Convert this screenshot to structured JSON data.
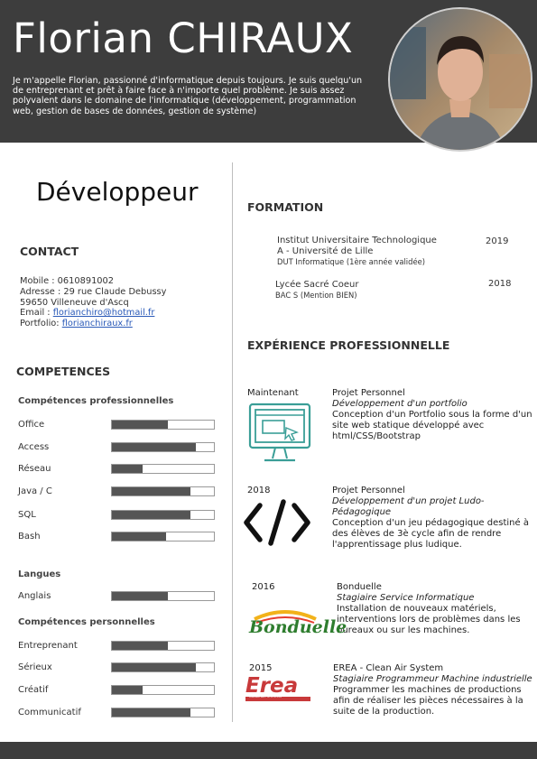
{
  "header": {
    "name": "Florian CHIRAUX",
    "intro": "Je m'appelle Florian, passionné d'informatique depuis toujours. Je suis quelqu'un de entreprenant et prêt à faire face à n'importe quel problème. Je suis assez polyvalent dans le domaine de l'informatique (développement, programmation web, gestion de bases de données, gestion de système)"
  },
  "role": "Développeur",
  "contact": {
    "title": "CONTACT",
    "mobile": "Mobile : 0610891002",
    "address1": "Adresse : 29 rue Claude Debussy",
    "address2": "59650 Villeneuve d'Ascq",
    "email_label": "Email : ",
    "email": "florianchiro@hotmail.fr",
    "portfolio_label": "Portfolio: ",
    "portfolio": "florianchiraux.fr"
  },
  "competences": {
    "title": "COMPETENCES",
    "pro_title": "Compétences professionnelles",
    "pro": [
      {
        "label": "Office",
        "level": 0.55
      },
      {
        "label": "Access",
        "level": 0.82
      },
      {
        "label": "Réseau",
        "level": 0.3
      },
      {
        "label": "Java / C",
        "level": 0.77
      },
      {
        "label": "SQL",
        "level": 0.77
      },
      {
        "label": "Bash",
        "level": 0.53
      }
    ],
    "lang_title": "Langues",
    "lang": [
      {
        "label": "Anglais",
        "level": 0.55
      }
    ],
    "perso_title": "Compétences personnelles",
    "perso": [
      {
        "label": "Entreprenant",
        "level": 0.55
      },
      {
        "label": "Sérieux",
        "level": 0.82
      },
      {
        "label": "Créatif",
        "level": 0.3
      },
      {
        "label": "Communicatif",
        "level": 0.77
      }
    ]
  },
  "formation": {
    "title": "FORMATION",
    "items": [
      {
        "school1": "Institut Universitaire Technologique",
        "school2": "A - Université de Lille",
        "detail": "DUT Informatique (1ère année validée)",
        "year": "2019"
      },
      {
        "school1": "Lycée Sacré Coeur",
        "detail": "BAC S (Mention BIEN)",
        "year": "2018"
      }
    ]
  },
  "experience": {
    "title": "EXPÉRIENCE PROFESSIONNELLE",
    "items": [
      {
        "date": "Maintenant",
        "org": "Projet Personnel",
        "role": "Développement d'un portfolio",
        "desc": "Conception d'un Portfolio sous la forme d'un site web statique développé avec html/CSS/Bootstrap",
        "icon": "monitor-icon"
      },
      {
        "date": "2018",
        "org": "Projet Personnel",
        "role": "Développement d'un projet Ludo-Pédagogique",
        "desc": "Conception d'un jeu pédagogique destiné à des élèves de 3è cycle afin de rendre l'apprentissage plus ludique.",
        "icon": "code-icon"
      },
      {
        "date": "2016",
        "org": "Bonduelle",
        "role": "Stagiaire Service Informatique",
        "desc": "Installation de nouveaux matériels, interventions lors de problèmes dans les bureaux ou sur les machines.",
        "logo": "Bonduelle"
      },
      {
        "date": "2015",
        "org": "EREA - Clean Air System",
        "role": "Stagiaire Programmeur Machine industrielle",
        "desc": "Programmer les machines de productions afin de réaliser les pièces nécessaires à la suite de la production.",
        "logo": "Erea",
        "logo_sub": "CLEAN AIR SYSTEMS"
      }
    ]
  },
  "colors": {
    "header_bg": "#3d3d3d",
    "bar_fill": "#555555",
    "icon_teal": "#3a9e97",
    "bonduelle_green": "#2e7d2e",
    "erea_red": "#c8393a"
  }
}
